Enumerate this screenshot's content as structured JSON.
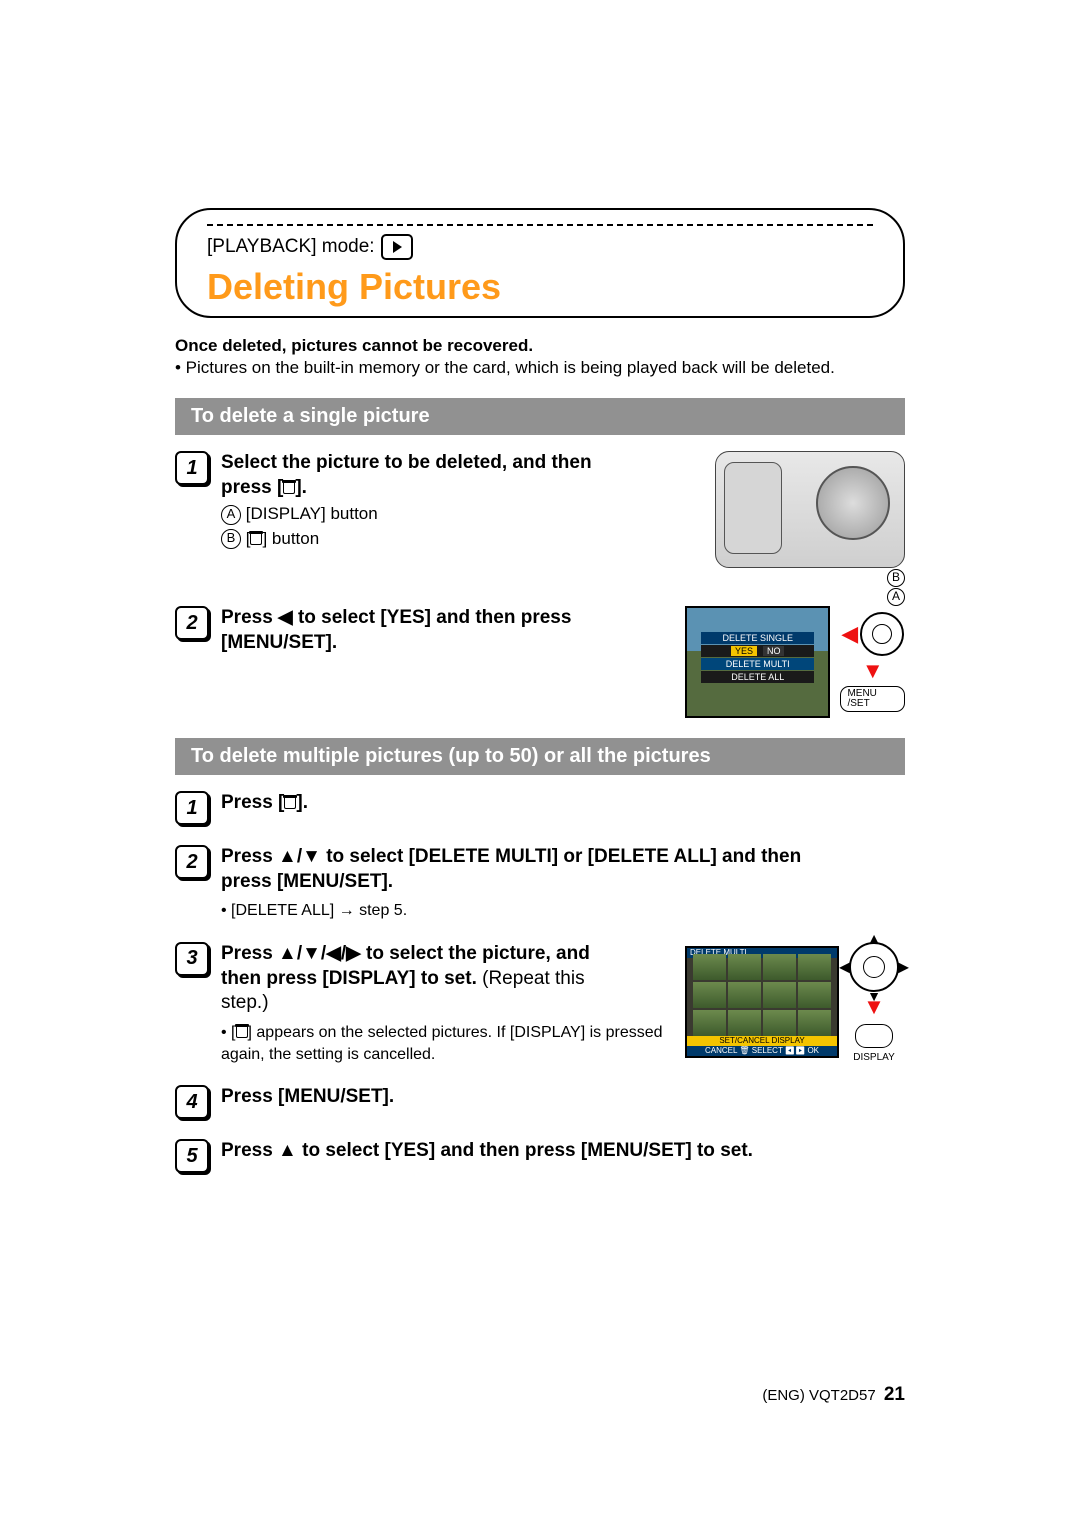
{
  "mode_label": "[PLAYBACK] mode:",
  "page_title": "Deleting Pictures",
  "intro_bold": "Once deleted, pictures cannot be recovered.",
  "intro_bullet": "• Pictures on the built-in memory or the card, which is being played back will be deleted.",
  "section1_title": "To delete a single picture",
  "s1_step1_line1": "Select the picture to be deleted, and then",
  "s1_step1_line2_prefix": "press [",
  "s1_step1_line2_suffix": "].",
  "s1_step1_keyA": "[DISPLAY] button",
  "s1_step1_keyB_prefix": "[",
  "s1_step1_keyB_suffix": "] button",
  "s1_step2_prefix": "Press ",
  "s1_step2_mid": " to select [YES] and then press",
  "s1_step2_line2": "[MENU/SET].",
  "lcd1_row_top": "DELETE SINGLE",
  "lcd1_yes": "YES",
  "lcd1_no": "NO",
  "lcd1_row3": "DELETE MULTI",
  "lcd1_row4": "DELETE ALL",
  "menuset_label": "MENU /SET",
  "section2_title": "To delete multiple pictures (up to 50) or all the pictures",
  "s2_step1_prefix": "Press [",
  "s2_step1_suffix": "].",
  "s2_step2_prefix": "Press ",
  "s2_step2_mid": " to select [DELETE MULTI] or [DELETE ALL] and then",
  "s2_step2_line2": "press [MENU/SET].",
  "s2_step2_bullet": "• [DELETE ALL] → step 5.",
  "s2_step3_prefix": "Press ",
  "s2_step3_mid": " to select the picture, and",
  "s2_step3_line2a": "then press [DISPLAY] to set.",
  "s2_step3_line2b": " (Repeat this",
  "s2_step3_line3": "step.)",
  "s2_step3_bullet_prefix": "• [",
  "s2_step3_bullet_suffix": "] appears on the selected pictures. If [DISPLAY] is pressed again, the setting is cancelled.",
  "lcd2_top": "DELETE MULTI",
  "lcd2_bar1": "SET/CANCEL DISPLAY",
  "lcd2_bar2": "CANCEL 🗑 SELECT ◀▶ OK",
  "display_label": "DISPLAY",
  "s2_step4": "Press [MENU/SET].",
  "s2_step5_prefix": "Press ",
  "s2_step5_suffix": " to select [YES] and then press [MENU/SET] to set.",
  "footer_code": "(ENG) VQT2D57",
  "footer_page": "21",
  "callout_A_label": "A",
  "callout_B_label": "B",
  "step_labels": {
    "n1": "1",
    "n2": "2",
    "n3": "3",
    "n4": "4",
    "n5": "5"
  },
  "arrows": {
    "left": "◀",
    "right": "▶",
    "up": "▲",
    "down": "▼",
    "updown": "▲/▼",
    "all": "▲/▼/◀/▶"
  }
}
